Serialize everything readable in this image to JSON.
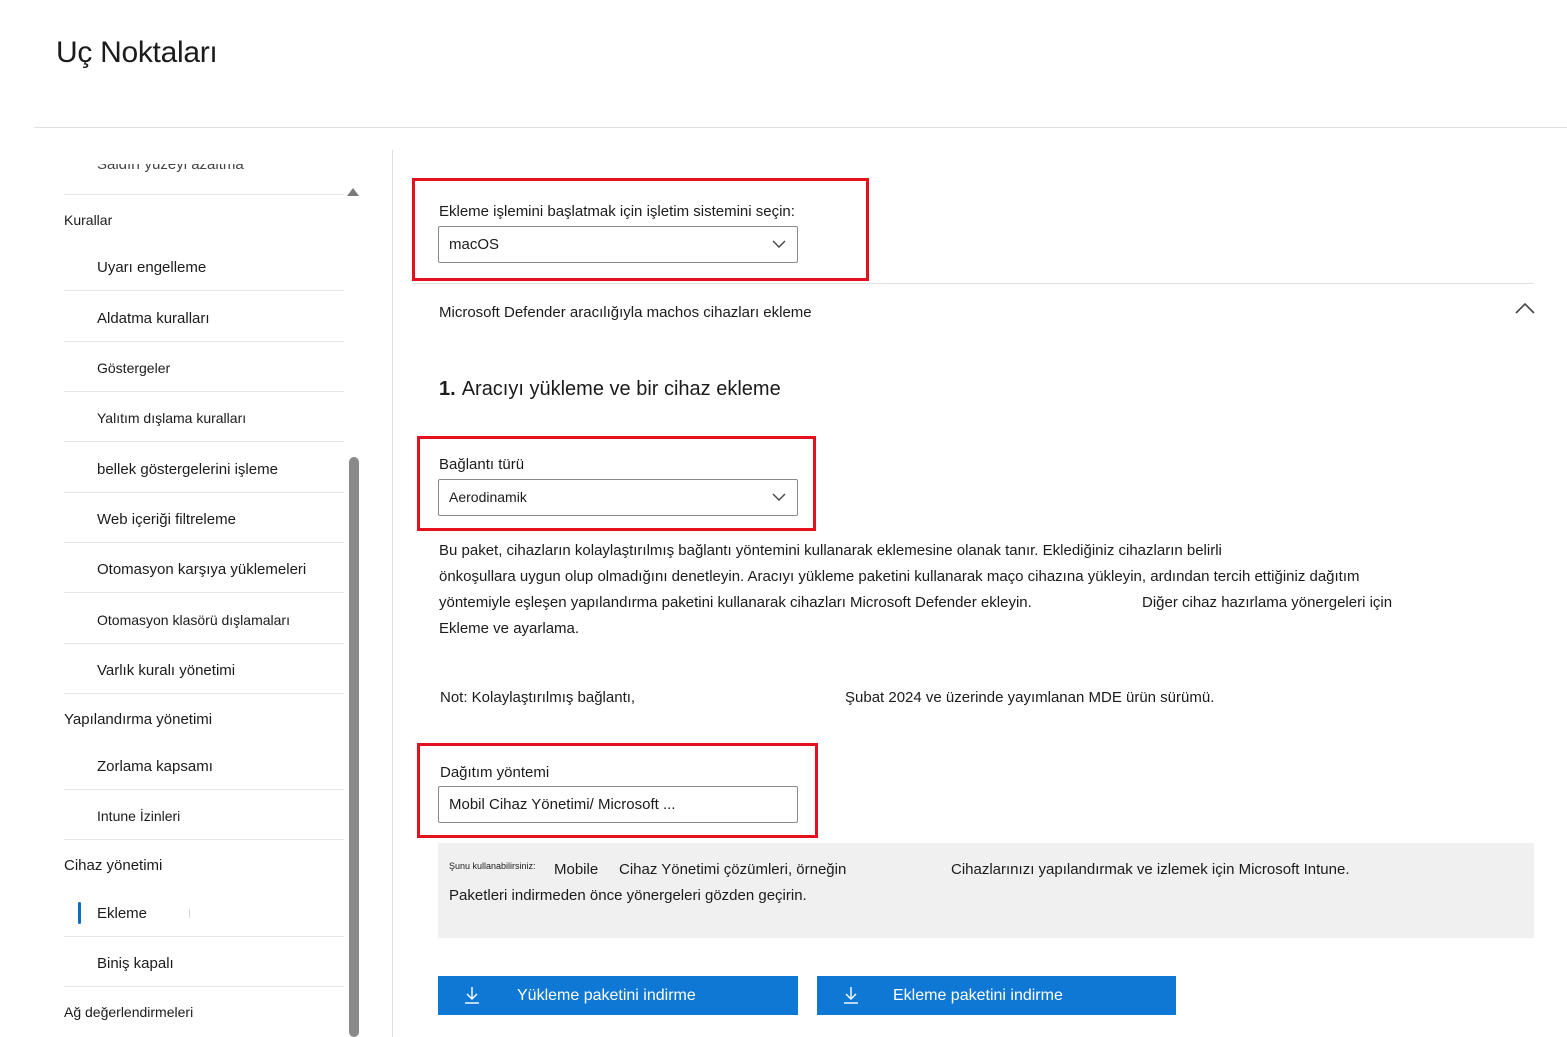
{
  "page": {
    "title": "Uç Noktaları"
  },
  "sidebar": {
    "cut_item": "Saldırı yüzeyi azaltma",
    "sections": {
      "rules": "Kurallar",
      "configuration": "Yapılandırma yönetimi",
      "device_management": "Cihaz yönetimi",
      "network": "Ağ değerlendirmeleri"
    },
    "items": {
      "alert_suppression": "Uyarı engelleme",
      "deception_rules": "Aldatma kuralları",
      "indicators": "Göstergeler",
      "isolation_exclusion": "Yalıtım dışlama kuralları",
      "process_memory": "bellek göstergelerini işleme",
      "web_content": "Web içeriği filtreleme",
      "auto_uploads": "Otomasyon karşıya yüklemeleri",
      "auto_folder_exclusions": "Otomasyon klasörü dışlamaları",
      "asset_rule": "Varlık kuralı yönetimi",
      "enforcement_scope": "Zorlama kapsamı",
      "intune_permissions": "Intune İzinleri",
      "onboarding": "Ekleme",
      "offboarding": "Biniş kapalı"
    },
    "active_item": "Ekleme"
  },
  "main": {
    "os_label": "Ekleme işlemini başlatmak için işletim sistemini seçin:",
    "os_value": "macOS",
    "section_title": "Microsoft Defender aracılığıyla machos cihazları ekleme",
    "step_number": "1.",
    "step_title": "Aracıyı yükleme ve bir cihaz ekleme",
    "connection_label": "Bağlantı türü",
    "connection_value": "Aerodinamik",
    "desc_line1": "Bu paket, cihazların kolaylaştırılmış bağlantı yöntemini kullanarak eklemesine olanak tanır. Eklediğiniz cihazların belirli",
    "desc_line2": "önkoşullara uygun olup olmadığını denetleyin. Aracıyı yükleme paketini kullanarak maço cihazına yükleyin, ardından tercih ettiğiniz dağıtım",
    "desc_line3a": "yöntemiyle eşleşen yapılandırma paketini kullanarak cihazları Microsoft Defender ekleyin.",
    "desc_line3b": "Diğer cihaz hazırlama yönergeleri için",
    "desc_line4": "Ekleme ve ayarlama.",
    "note_a": "Not: Kolaylaştırılmış bağlantı,",
    "note_b": "Şubat 2024 ve üzerinde yayımlanan MDE ürün sürümü.",
    "deploy_label": "Dağıtım yöntemi",
    "deploy_value": "Mobil Cihaz Yönetimi/ Microsoft ...",
    "info_small": "Şunu kullanabilirsiniz:",
    "info_a": "Mobile",
    "info_b": "Cihaz Yönetimi çözümleri, örneğin",
    "info_c": "Cihazlarınızı yapılandırmak ve izlemek için Microsoft Intune.",
    "info_line2": "Paketleri indirmeden önce yönergeleri gözden geçirin.",
    "btn_install": "Yükleme paketini indirme",
    "btn_onboard": "Ekleme paketini indirme"
  },
  "colors": {
    "accent": "#0f78d4",
    "highlight": "#e3101e",
    "active_indicator": "#0f6cbd"
  },
  "icons": [
    "chevron-down-icon",
    "chevron-up-icon",
    "download-icon"
  ]
}
